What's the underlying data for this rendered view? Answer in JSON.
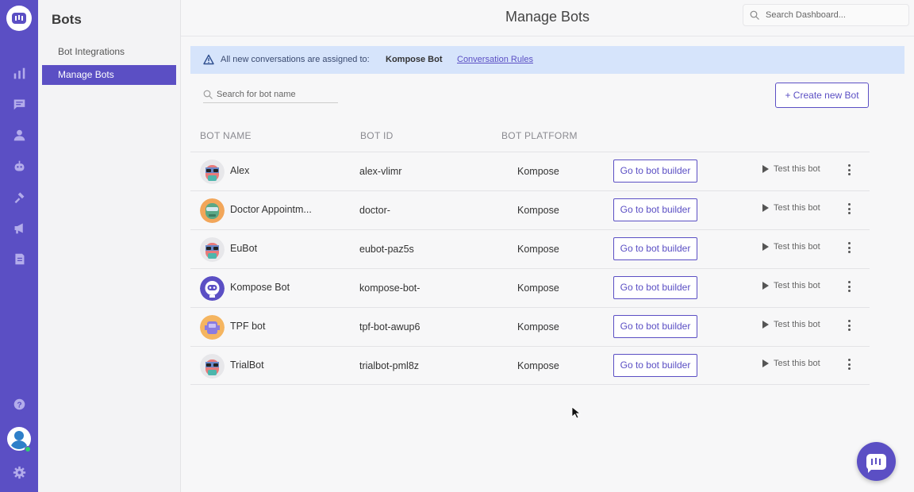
{
  "colors": {
    "brand": "#5b4fc4",
    "banner_bg": "#d6e4fb"
  },
  "rail": {
    "icons": [
      "logo-icon",
      "reports-icon",
      "conversations-icon",
      "contacts-icon",
      "bot-icon",
      "integrations-icon",
      "campaigns-icon",
      "knowledge-icon",
      "help-icon",
      "user-avatar",
      "settings-icon"
    ]
  },
  "sidebar": {
    "title": "Bots",
    "items": [
      {
        "label": "Bot Integrations",
        "active": false
      },
      {
        "label": "Manage Bots",
        "active": true
      }
    ]
  },
  "header": {
    "title": "Manage Bots",
    "search_placeholder": "Search Dashboard..."
  },
  "banner": {
    "text": "All new conversations are assigned to:",
    "bot": "Kompose Bot",
    "link": "Conversation Rules"
  },
  "toolbar": {
    "search_placeholder": "Search for bot name",
    "create_label": "+ Create new Bot"
  },
  "table": {
    "headers": [
      "BOT NAME",
      "BOT ID",
      "BOT PLATFORM"
    ],
    "rows": [
      {
        "name": "Alex",
        "id": "alex-vlimr",
        "platform": "Kompose",
        "builder": "Go to bot builder",
        "test": "Test this bot"
      },
      {
        "name": "Doctor Appointm...",
        "id": "doctor-",
        "platform": "Kompose",
        "builder": "Go to bot builder",
        "test": "Test this bot"
      },
      {
        "name": "EuBot",
        "id": "eubot-paz5s",
        "platform": "Kompose",
        "builder": "Go to bot builder",
        "test": "Test this bot"
      },
      {
        "name": "Kompose Bot",
        "id": "kompose-bot-",
        "platform": "Kompose",
        "builder": "Go to bot builder",
        "test": "Test this bot"
      },
      {
        "name": "TPF bot",
        "id": "tpf-bot-awup6",
        "platform": "Kompose",
        "builder": "Go to bot builder",
        "test": "Test this bot"
      },
      {
        "name": "TrialBot",
        "id": "trialbot-pml8z",
        "platform": "Kompose",
        "builder": "Go to bot builder",
        "test": "Test this bot"
      }
    ]
  }
}
